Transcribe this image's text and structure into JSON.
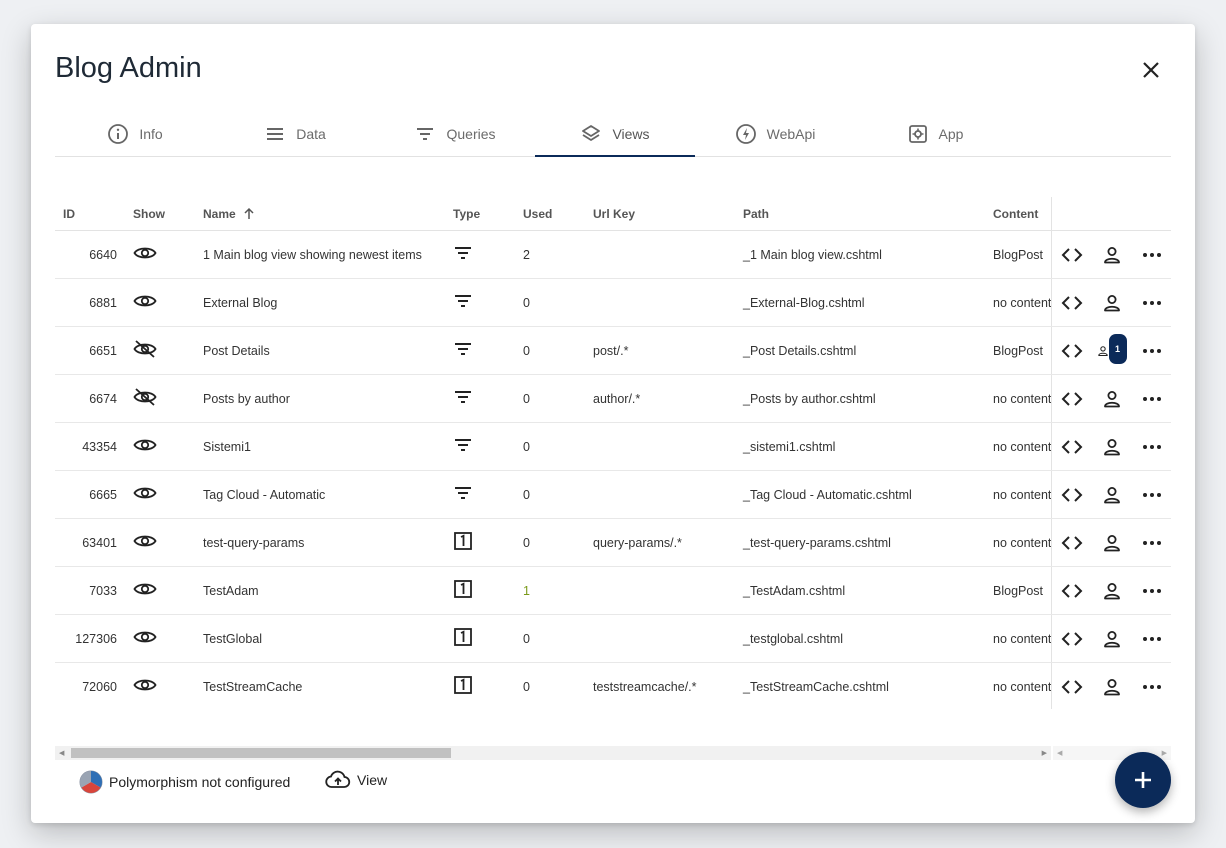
{
  "dialog": {
    "title": "Blog Admin"
  },
  "tabs": [
    {
      "label": "Info",
      "icon": "info-icon"
    },
    {
      "label": "Data",
      "icon": "menu-icon"
    },
    {
      "label": "Queries",
      "icon": "filter-icon"
    },
    {
      "label": "Views",
      "icon": "layers-icon",
      "active": true
    },
    {
      "label": "WebApi",
      "icon": "bolt-icon"
    },
    {
      "label": "App",
      "icon": "settings-icon"
    }
  ],
  "table": {
    "headers": {
      "id": "ID",
      "show": "Show",
      "name": "Name",
      "type": "Type",
      "used": "Used",
      "urlkey": "Url Key",
      "path": "Path",
      "content": "Content"
    },
    "rows": [
      {
        "id": "6640",
        "show": "visible",
        "name": "1 Main blog view showing newest items",
        "type": "query",
        "used": "2",
        "urlkey": "",
        "path": "_1 Main blog view.cshtml",
        "content": "BlogPost",
        "badge": ""
      },
      {
        "id": "6881",
        "show": "visible",
        "name": "External Blog",
        "type": "query",
        "used": "0",
        "urlkey": "",
        "path": "_External-Blog.cshtml",
        "content": "no content",
        "badge": ""
      },
      {
        "id": "6651",
        "show": "hidden",
        "name": "Post Details",
        "type": "query",
        "used": "0",
        "urlkey": "post/.*",
        "path": "_Post Details.cshtml",
        "content": "BlogPost",
        "badge": "1"
      },
      {
        "id": "6674",
        "show": "hidden",
        "name": "Posts by author",
        "type": "query",
        "used": "0",
        "urlkey": "author/.*",
        "path": "_Posts by author.cshtml",
        "content": "no content",
        "badge": ""
      },
      {
        "id": "43354",
        "show": "visible",
        "name": "Sistemi1",
        "type": "query",
        "used": "0",
        "urlkey": "",
        "path": "_sistemi1.cshtml",
        "content": "no content",
        "badge": ""
      },
      {
        "id": "6665",
        "show": "visible",
        "name": "Tag Cloud - Automatic",
        "type": "query",
        "used": "0",
        "urlkey": "",
        "path": "_Tag Cloud - Automatic.cshtml",
        "content": "no content",
        "badge": ""
      },
      {
        "id": "63401",
        "show": "visible",
        "name": "test-query-params",
        "type": "single",
        "used": "0",
        "urlkey": "query-params/.*",
        "path": "_test-query-params.cshtml",
        "content": "no content",
        "badge": ""
      },
      {
        "id": "7033",
        "show": "visible",
        "name": "TestAdam",
        "type": "single",
        "used": "1",
        "urlkey": "",
        "path": "_TestAdam.cshtml",
        "content": "BlogPost",
        "badge": ""
      },
      {
        "id": "127306",
        "show": "visible",
        "name": "TestGlobal",
        "type": "single",
        "used": "0",
        "urlkey": "",
        "path": "_testglobal.cshtml",
        "content": "no content",
        "badge": ""
      },
      {
        "id": "72060",
        "show": "visible",
        "name": "TestStreamCache",
        "type": "single",
        "used": "0",
        "urlkey": "teststreamcache/.*",
        "path": "_TestStreamCache.cshtml",
        "content": "no content",
        "badge": ""
      }
    ]
  },
  "footer": {
    "polymorphism_label": "Polymorphism not configured",
    "view_label": "View"
  },
  "colors": {
    "accent": "#0b2a59",
    "used_highlight": "#7a9a1a"
  }
}
